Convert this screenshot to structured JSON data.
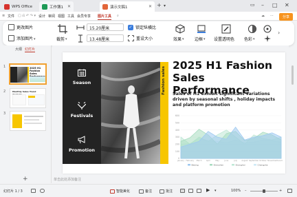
{
  "app": {
    "brand": "WPS Office",
    "tabs": [
      {
        "label": "工作簿1"
      },
      {
        "label": "演示文稿1"
      }
    ],
    "new_tab": "+",
    "tab_menu": "▾"
  },
  "menubar": {
    "file": "文件",
    "items": [
      "开始",
      "插入",
      "设计",
      "切换",
      "动画",
      "放映",
      "审阅",
      "视图",
      "工具",
      "会员专享",
      "图片工具"
    ],
    "active": "图片工具",
    "share": "分享"
  },
  "ribbon": {
    "change_picture": "更改图片",
    "add_picture": "添加图片",
    "crop": "裁剪",
    "width_value": "15.20厘米",
    "height_value": "13.48厘米",
    "lock_ratio": "锁定纵横比",
    "reset_size": "重设大小",
    "effect": "效果",
    "border": "边框",
    "set_transparent": "设置透明色",
    "color": "色彩"
  },
  "leftpanel": {
    "tab_outline": "大纲",
    "tab_slides": "幻灯片",
    "thumbnails": [
      {
        "num": "1"
      },
      {
        "num": "2"
      },
      {
        "num": "3"
      }
    ],
    "thumb2_title": "Monthly Sales Trend Analysis",
    "add_slide": "+"
  },
  "slide": {
    "title": "2025 H1 Fashion Sales Performance",
    "subtitle": "Sales of H1 exhibit significant variations driven by seasonal shifts , holiday impacts and platform promotion",
    "side_label": "Fashion sales",
    "panels": [
      {
        "label": "Season",
        "icon": "calendar-grid-icon"
      },
      {
        "label": "Festivals",
        "icon": "festival-icon"
      },
      {
        "label": "Promotion",
        "icon": "megaphone-icon"
      }
    ]
  },
  "chart_data": {
    "type": "area",
    "categories": [
      "January",
      "February",
      "March",
      "April",
      "May",
      "June",
      "July",
      "August",
      "September",
      "October",
      "November",
      "December"
    ],
    "yticks": [
      0,
      100,
      200,
      300,
      400,
      500,
      600
    ],
    "ylim": [
      0,
      600
    ],
    "legend_position": "bottom",
    "series": [
      {
        "name": "Beijing",
        "color": "#9ec9f0",
        "values": [
          160,
          200,
          240,
          380,
          300,
          270,
          440,
          260,
          300,
          320,
          360,
          300
        ]
      },
      {
        "name": "Shenzhen",
        "color": "#a8dcc0",
        "values": [
          240,
          290,
          410,
          330,
          200,
          350,
          380,
          250,
          280,
          370,
          330,
          260
        ]
      },
      {
        "name": "Shanghai",
        "color": "#bfe8d6",
        "values": [
          300,
          200,
          300,
          240,
          330,
          400,
          300,
          200,
          330,
          280,
          260,
          300
        ]
      },
      {
        "name": "Changsha",
        "color": "#cfeaf6",
        "values": [
          200,
          210,
          280,
          250,
          240,
          220,
          260,
          220,
          230,
          260,
          250,
          230
        ]
      }
    ]
  },
  "notes": {
    "placeholder": "单击此处添加备注"
  },
  "statusbar": {
    "slide_counter": "幻灯片 1 / 3",
    "smart_beautify": "智能美化",
    "notes": "备注",
    "comments": "批注",
    "zoom": "100%"
  },
  "colors": {
    "brand_red": "#c0392b",
    "accent_yellow": "#f7c600",
    "dark_panel": "#232323",
    "share_orange": "#f7931e"
  }
}
